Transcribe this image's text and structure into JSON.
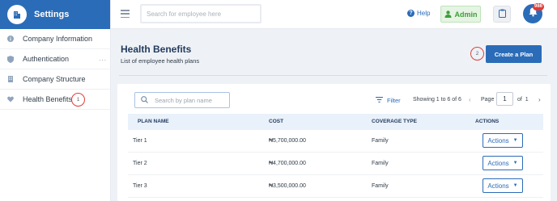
{
  "app": {
    "title": "Settings"
  },
  "sidebar": {
    "items": [
      {
        "label": "Company Information",
        "icon": "info-icon"
      },
      {
        "label": "Authentication",
        "icon": "shield-icon",
        "more": "..."
      },
      {
        "label": "Company Structure",
        "icon": "building-icon"
      },
      {
        "label": "Health Benefits",
        "icon": "heart-icon",
        "active": true
      }
    ],
    "marker": "1"
  },
  "topbar": {
    "search_placeholder": "Search for employee here",
    "help_label": "Help",
    "admin_label": "Admin",
    "notification_count": "986"
  },
  "page": {
    "title": "Health Benefits",
    "subtitle": "List of employee health plans",
    "create_button": "Create a Plan",
    "marker": "2"
  },
  "table_controls": {
    "search_placeholder": "Search by plan name",
    "filter_label": "Filter",
    "showing": "Showing 1 to 6 of 6",
    "page_label": "Page",
    "page_value": "1",
    "of_label": "of",
    "total_pages": "1"
  },
  "table": {
    "headers": [
      "PLAN NAME",
      "COST",
      "COVERAGE TYPE",
      "ACTIONS"
    ],
    "rows": [
      {
        "plan": "Tier 1",
        "cost": "₦5,700,000.00",
        "coverage": "Family",
        "action": "Actions"
      },
      {
        "plan": "Tier 2",
        "cost": "₦4,700,000.00",
        "coverage": "Family",
        "action": "Actions"
      },
      {
        "plan": "Tier 3",
        "cost": "₦3,500,000.00",
        "coverage": "Family",
        "action": "Actions"
      }
    ]
  },
  "colors": {
    "brand": "#2b6cb8",
    "admin_green": "#3f9e3a",
    "badge_red": "#e23b34",
    "marker_red": "#e0403a"
  }
}
